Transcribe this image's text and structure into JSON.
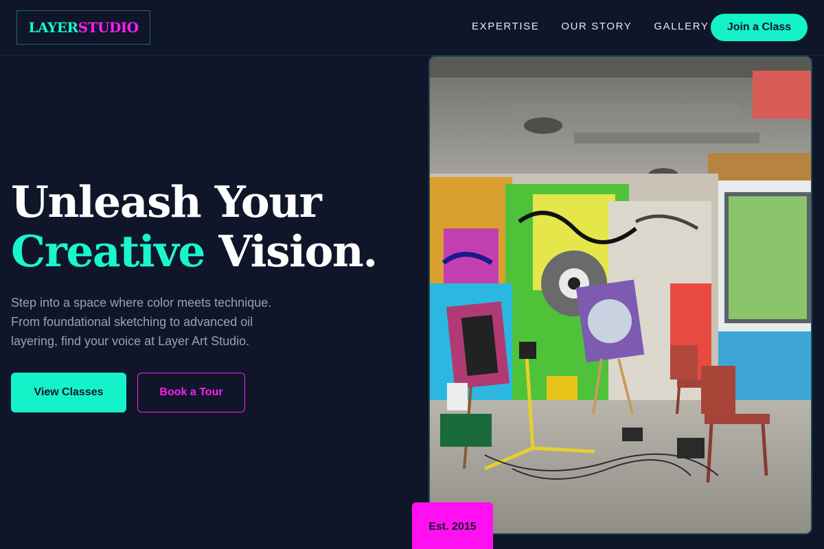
{
  "brand": {
    "part1": "LAYER",
    "part2": "STUDIO"
  },
  "nav": {
    "links": [
      "EXPERTISE",
      "OUR STORY",
      "GALLERY"
    ],
    "cta": "Join a Class"
  },
  "hero": {
    "headline_line1": "Unleash Your",
    "headline_accent": "Creative",
    "headline_rest": " Vision.",
    "subtext": "Step into a space where color meets technique. From foundational sketching to advanced oil layering, find your voice at Layer Art Studio.",
    "primary_button": "View Classes",
    "secondary_button": "Book a Tour",
    "badge": "Est. 2015",
    "image_alt": "Graffiti-covered art studio with easels"
  },
  "colors": {
    "background": "#0f1629",
    "accent_teal": "#13f2c9",
    "accent_magenta": "#ff1ef5",
    "muted_text": "#94a3b8"
  }
}
